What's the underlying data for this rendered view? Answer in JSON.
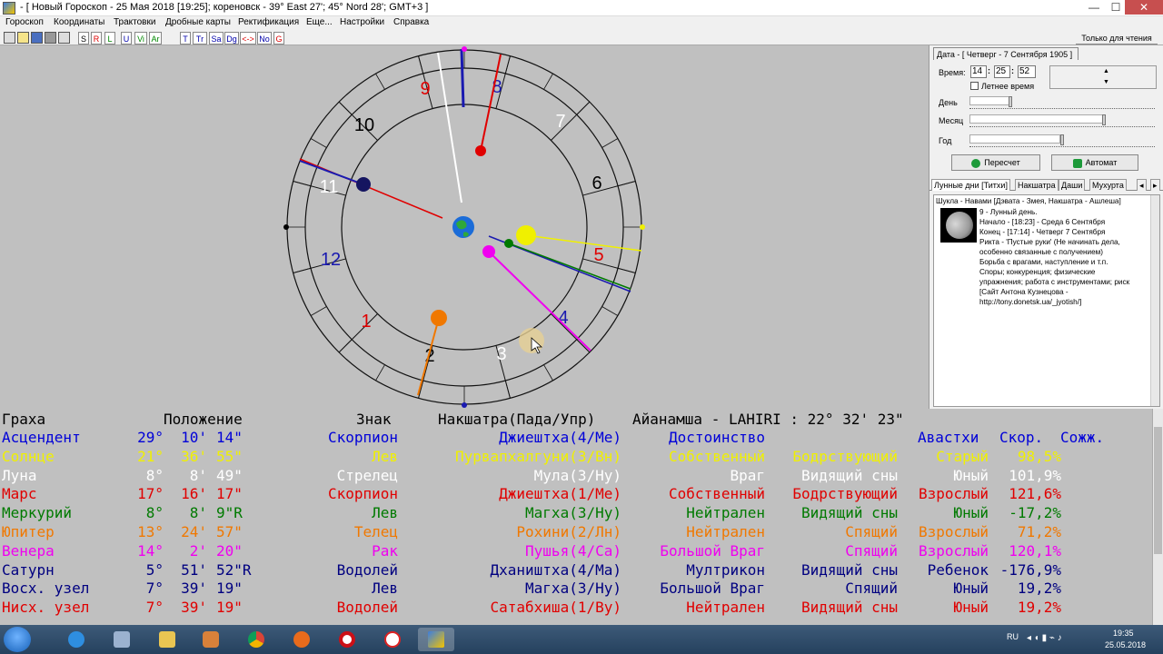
{
  "window": {
    "title": "- [ Новый Гороскоп - 25 Мая 2018 [19:25]; кореновск - 39° East 27'; 45° Nord 28'; GMT+3 ]",
    "min": "—",
    "max": "☐",
    "close": "✕"
  },
  "menu": [
    "Гороскоп",
    "Координаты",
    "Трактовки",
    "Дробные карты",
    "Ректификация",
    "Еще...",
    "Настройки",
    "Справка"
  ],
  "toolbar": {
    "buttons": [
      "S",
      "R",
      "L",
      "U",
      "Vi",
      "Ar",
      "T",
      "Tr",
      "Sa",
      "Dg",
      "<->",
      "No",
      "G"
    ],
    "readonly_label": "Только для чтения"
  },
  "chart": {
    "house_numbers": [
      "1",
      "2",
      "3",
      "4",
      "5",
      "6",
      "7",
      "8",
      "9",
      "10",
      "11",
      "12"
    ]
  },
  "right_panel": {
    "date_tab": "Дата - [ Четверг   -  7 Сентября 1905 ]",
    "time_label": "Время:",
    "hours": "14",
    "minutes": "25",
    "seconds": "52",
    "summer_time": "Летнее время",
    "day_label": "День",
    "month_label": "Месяц",
    "year_label": "Год",
    "recalc_button": "Пересчет",
    "auto_button": "Автомат",
    "tabs": [
      "Лунные дни [Титхи]",
      "Накшатра",
      "Даши",
      "Мухурта"
    ],
    "info": {
      "header": "Шукла - Навами [Дэвата - Змея, Накшатра - Ашлеша]",
      "lines": [
        "9 - Лунный день.",
        "  Начало - [18:23] -  Среда       6 Сентября",
        "  Конец  - [17:14] -  Четверг    7 Сентября",
        "Рикта - 'Пустые руки' (Не начинать дела,",
        "особенно связанные с получением)",
        "Борьба с врагами, наступление и т.п.",
        "  Споры; конкуренция; физические",
        "упражнения; работа с инструментами; риск",
        " [Сайт Антона Кузнецова -",
        "http://tony.donetsk.ua/_jyotish/]"
      ]
    }
  },
  "table": {
    "headers": [
      "Граха",
      "Положение",
      "Знак",
      "Накшатра(Пада/Упр)",
      "Айанамша - LAHIRI : 22° 32' 23\"",
      "Авастхи",
      "Скор.",
      "Сожж."
    ],
    "rows": [
      {
        "name": "Асцендент",
        "deg": "29°",
        "min": "10'",
        "sec": "14\"",
        "sign": "Скорпион",
        "nak": "Джиештха(4/Ме)",
        "dig": "Достоинство",
        "awake": "",
        "age": "",
        "speed": "",
        "color": "#0000d8"
      },
      {
        "name": "Солнце",
        "deg": "21°",
        "min": "36'",
        "sec": "55\"",
        "sign": "Лев",
        "nak": "Пурвапхалгуни(3/Вн)",
        "dig": "Собственный",
        "awake": "Бодрствующий",
        "age": "Старый",
        "speed": "98,5%",
        "color": "#f0f000"
      },
      {
        "name": "Луна",
        "deg": "8°",
        "min": "8'",
        "sec": "49\"",
        "sign": "Стрелец",
        "nak": "Мула(3/Ну)",
        "dig": "Враг",
        "awake": "Видящий сны",
        "age": "Юный",
        "speed": "101,9%",
        "color": "#ffffff"
      },
      {
        "name": "Марс",
        "deg": "17°",
        "min": "16'",
        "sec": "17\"",
        "sign": "Скорпион",
        "nak": "Джиештха(1/Ме)",
        "dig": "Собственный",
        "awake": "Бодрствующий",
        "age": "Взрослый",
        "speed": "121,6%",
        "color": "#e00000"
      },
      {
        "name": "Меркурий",
        "deg": "8°",
        "min": "8'",
        "sec": "9\"R",
        "sign": "Лев",
        "nak": "Магха(3/Ну)",
        "dig": "Нейтрален",
        "awake": "Видящий сны",
        "age": "Юный",
        "speed": "-17,2%",
        "color": "#007a00"
      },
      {
        "name": "Юпитер",
        "deg": "13°",
        "min": "24'",
        "sec": "57\"",
        "sign": "Телец",
        "nak": "Рохини(2/Лн)",
        "dig": "Нейтрален",
        "awake": "Спящий",
        "age": "Взрослый",
        "speed": "71,2%",
        "color": "#f07800"
      },
      {
        "name": "Венера",
        "deg": "14°",
        "min": "2'",
        "sec": "20\"",
        "sign": "Рак",
        "nak": "Пушья(4/Са)",
        "dig": "Большой Враг",
        "awake": "Спящий",
        "age": "Взрослый",
        "speed": "120,1%",
        "color": "#f000f0"
      },
      {
        "name": "Сатурн",
        "deg": "5°",
        "min": "51'",
        "sec": "52\"R",
        "sign": "Водолей",
        "nak": "Дхаништха(4/Ма)",
        "dig": "Мултрикон",
        "awake": "Видящий сны",
        "age": "Ребенок",
        "speed": "-176,9%",
        "color": "#000080"
      },
      {
        "name": "Восх. узел",
        "deg": "7°",
        "min": "39'",
        "sec": "19\"",
        "sign": "Лев",
        "nak": "Магха(3/Ну)",
        "dig": "Большой Враг",
        "awake": "Спящий",
        "age": "Юный",
        "speed": "19,2%",
        "color": "#000080"
      },
      {
        "name": "Нисх. узел",
        "deg": "7°",
        "min": "39'",
        "sec": "19\"",
        "sign": "Водолей",
        "nak": "Сатабхиша(1/Ву)",
        "dig": "Нейтрален",
        "awake": "Видящий сны",
        "age": "Юный",
        "speed": "19,2%",
        "color": "#e00000"
      }
    ]
  },
  "tray": {
    "lang": "RU",
    "time": "19:35",
    "date": "25.05.2018"
  }
}
